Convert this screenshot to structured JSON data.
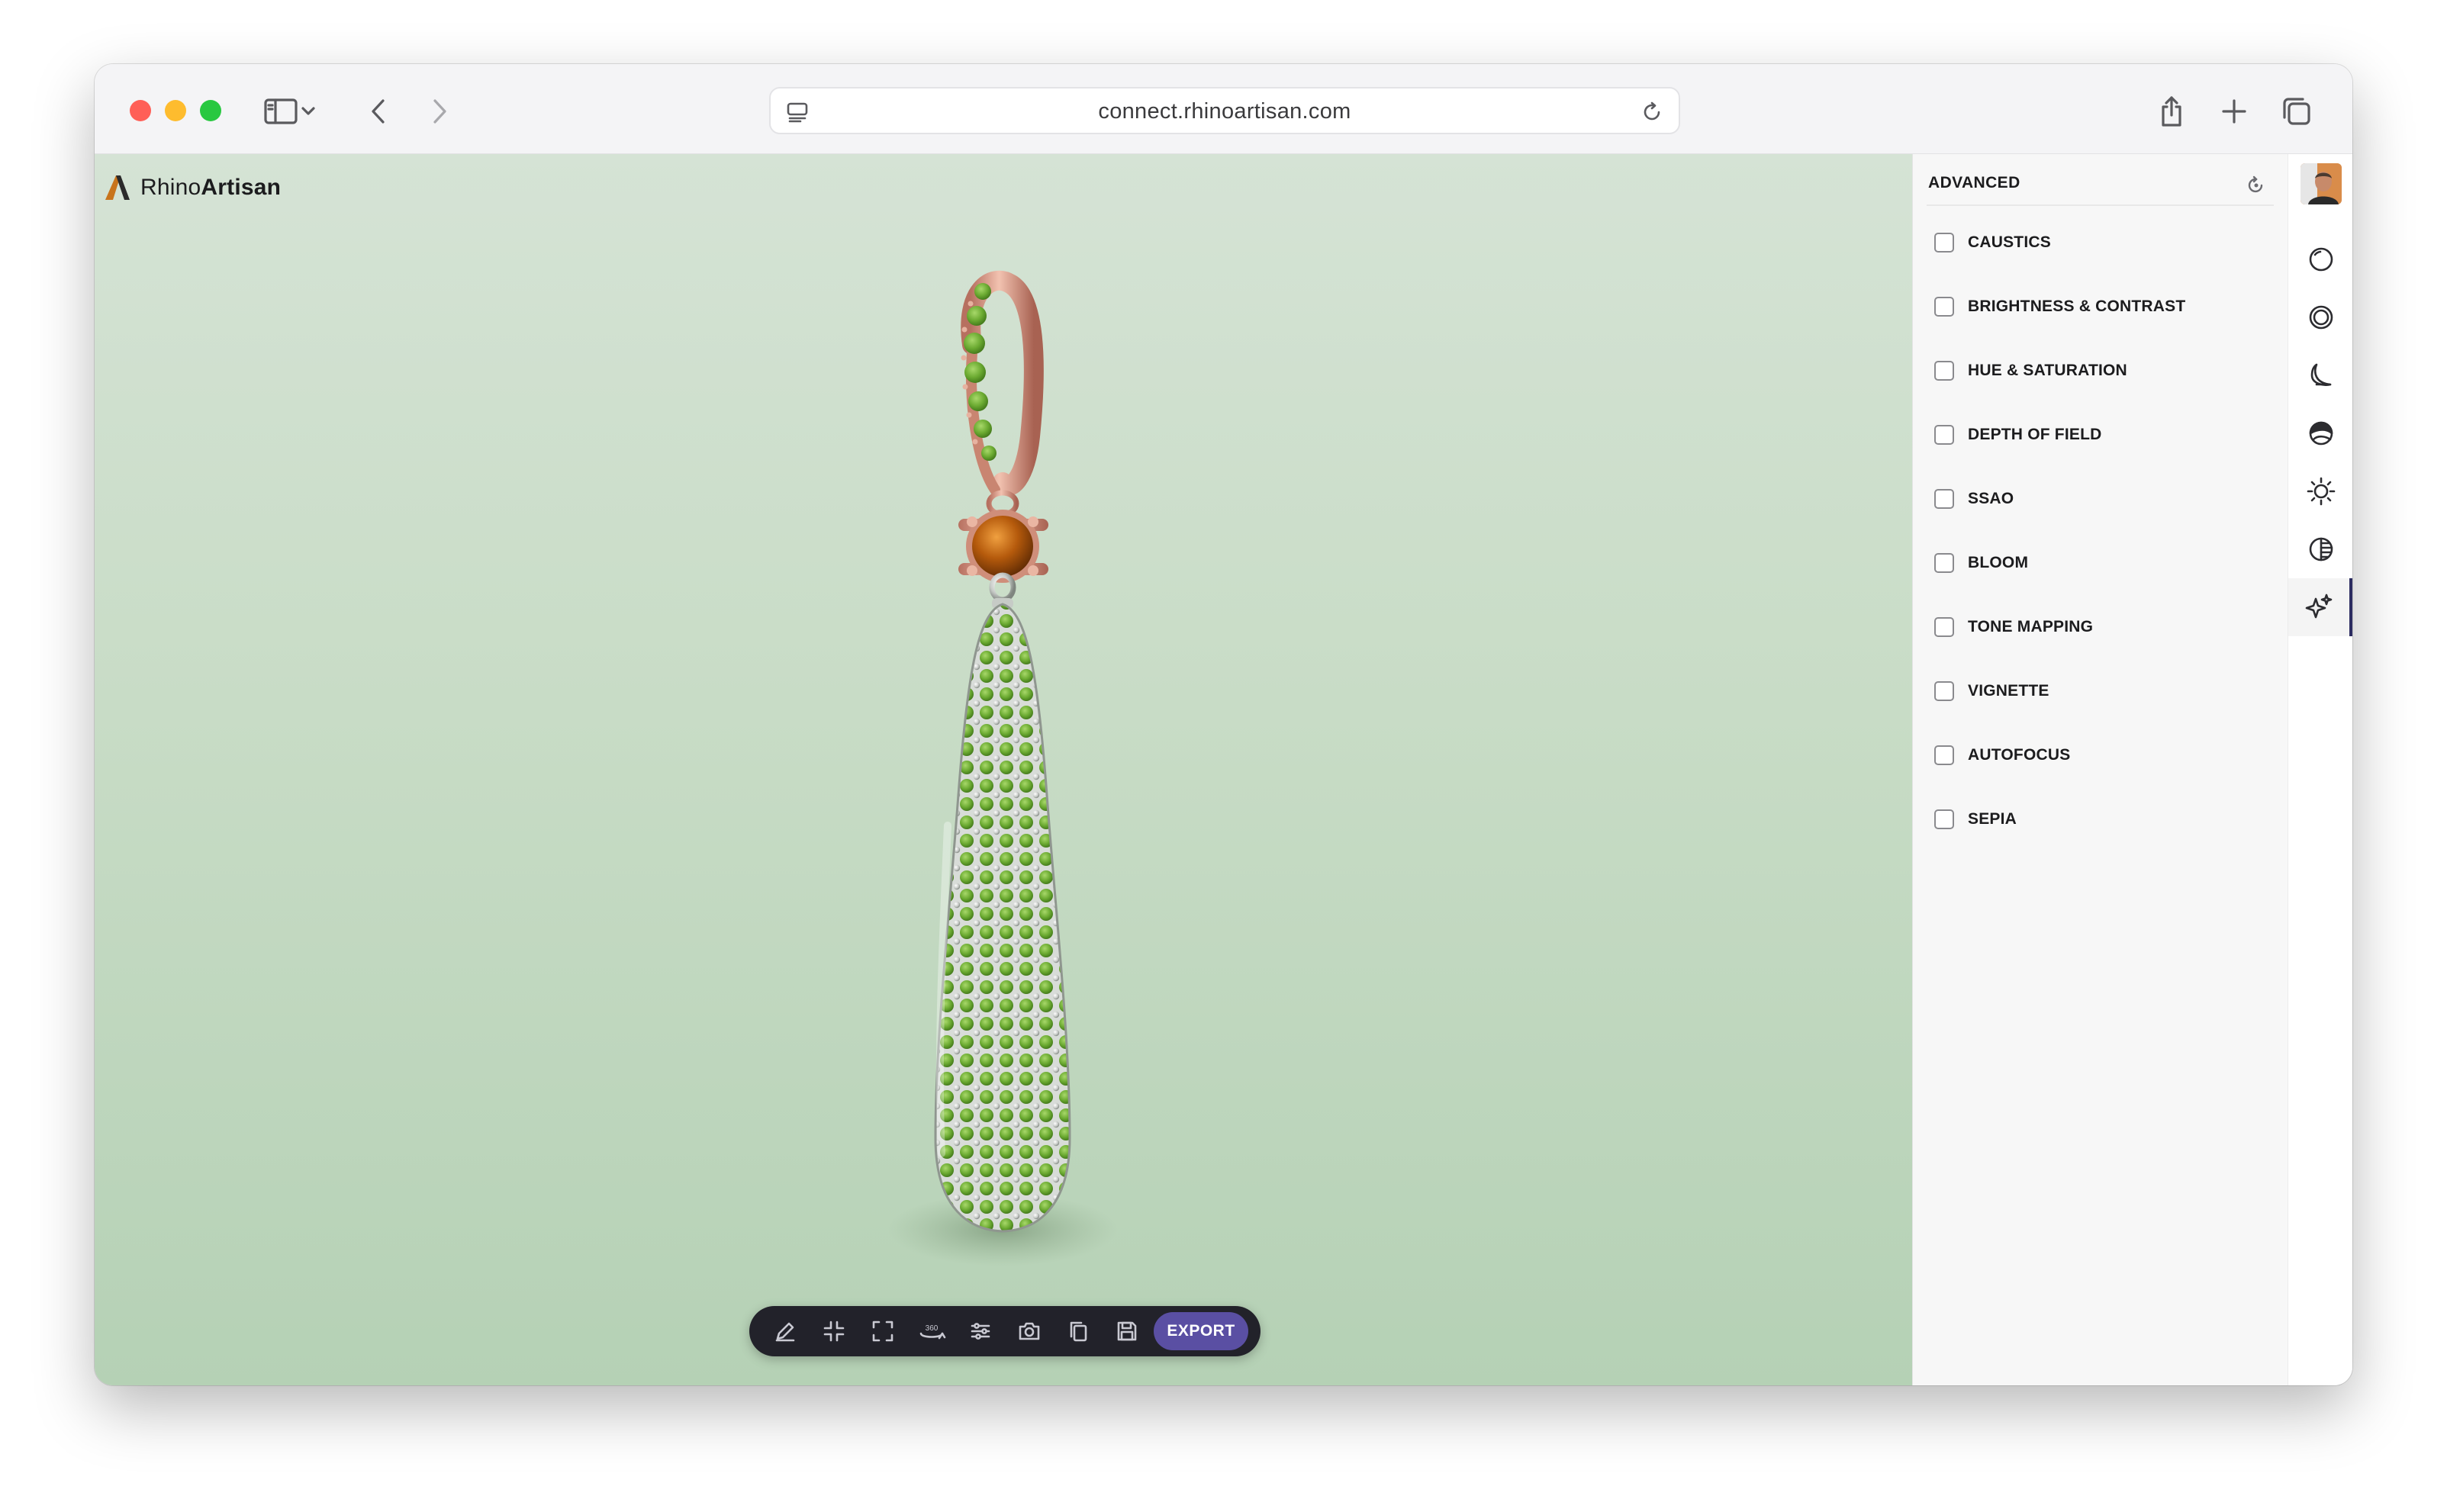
{
  "browser": {
    "url": "connect.rhinoartisan.com"
  },
  "brand": {
    "name_light": "Rhino",
    "name_bold": "Artisan"
  },
  "toolbar": {
    "tools": [
      "edit-icon",
      "shrink-icon",
      "expand-icon",
      "rotate-360-icon",
      "sliders-icon",
      "camera-icon",
      "copy-icon",
      "save-icon"
    ],
    "rotate_label": "360",
    "export_label": "EXPORT",
    "export_color": "#5a4fa3"
  },
  "panel": {
    "title": "ADVANCED",
    "options": [
      {
        "label": "CAUSTICS",
        "checked": false
      },
      {
        "label": "BRIGHTNESS & CONTRAST",
        "checked": false
      },
      {
        "label": "HUE & SATURATION",
        "checked": false
      },
      {
        "label": "DEPTH OF FIELD",
        "checked": false
      },
      {
        "label": "SSAO",
        "checked": false
      },
      {
        "label": "BLOOM",
        "checked": false
      },
      {
        "label": "TONE MAPPING",
        "checked": false
      },
      {
        "label": "VIGNETTE",
        "checked": false
      },
      {
        "label": "AUTOFOCUS",
        "checked": false
      },
      {
        "label": "SEPIA",
        "checked": false
      }
    ]
  },
  "rail": {
    "items": [
      "material-icon",
      "environment-icon",
      "shadow-icon",
      "scene-icon",
      "lighting-icon",
      "contrast-icon",
      "advanced-effects-icon"
    ],
    "active": "advanced-effects-icon"
  },
  "colors": {
    "background_top": "#d5e3d5",
    "background_bottom": "#b5d1b5",
    "gem_green": "#6cab32",
    "gem_orange": "#b55a0c",
    "metal_rose": "#d99a85"
  }
}
